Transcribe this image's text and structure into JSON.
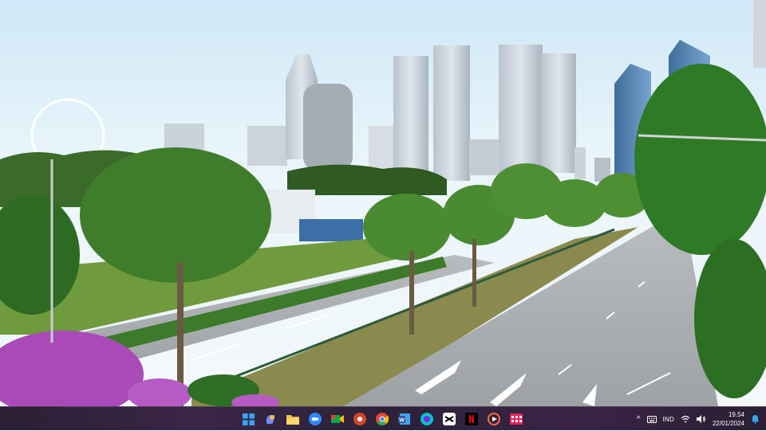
{
  "wallpaper": {
    "description_name": "city-boulevard-wallpaper"
  },
  "taskbar": {
    "pinned": [
      {
        "name": "start-button",
        "icon": "windows-icon",
        "color": "#3aa3f5"
      },
      {
        "name": "copilot-button",
        "icon": "copilot-icon",
        "color": "#6b8cff"
      },
      {
        "name": "file-explorer-button",
        "icon": "folder-icon",
        "color": "#f2c14e"
      },
      {
        "name": "zoom-button",
        "icon": "zoom-icon",
        "color": "#2d8cff"
      },
      {
        "name": "google-meet-button",
        "icon": "meet-icon",
        "color": "#00ac47"
      },
      {
        "name": "powerpoint-button",
        "icon": "powerpoint-icon",
        "color": "#d24726"
      },
      {
        "name": "chrome-button",
        "icon": "chrome-icon",
        "color": "#ea4335"
      },
      {
        "name": "word-button",
        "icon": "word-icon",
        "color": "#2b579a"
      },
      {
        "name": "canva-button",
        "icon": "canva-icon",
        "color": "#00c4cc"
      },
      {
        "name": "capcut-button",
        "icon": "capcut-icon",
        "color": "#ffffff"
      },
      {
        "name": "netflix-button",
        "icon": "netflix-icon",
        "color": "#e50914"
      },
      {
        "name": "media-player-button",
        "icon": "play-icon",
        "color": "#ff6a3d"
      },
      {
        "name": "app-button",
        "icon": "grid-app-icon",
        "color": "#e0245e"
      }
    ],
    "tray": {
      "language": "IND",
      "time": "19.54",
      "date": "22/01/2024"
    }
  }
}
